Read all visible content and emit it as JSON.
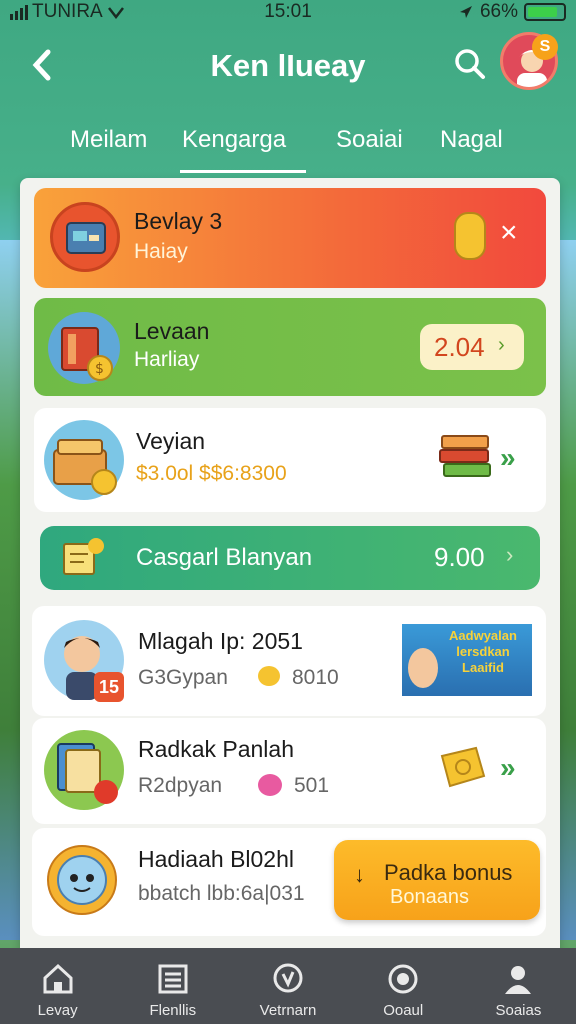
{
  "status": {
    "carrier": "TUNIRA",
    "time": "15:01",
    "battery": "66%"
  },
  "header": {
    "back_icon": "chevron-left-icon",
    "title": "Ken lIueay",
    "search_icon": "search-icon",
    "avatar_badge": "S"
  },
  "tabs": [
    {
      "label": "Meilam"
    },
    {
      "label": "Kengarga"
    },
    {
      "label": "Soaiai"
    },
    {
      "label": "Nagal"
    }
  ],
  "cards": {
    "c1": {
      "title": "Bevlay 3",
      "subtitle": "Haiay",
      "colors": [
        "#f9a23a",
        "#f2493d"
      ]
    },
    "c2": {
      "title": "Levaan",
      "subtitle": "Harliay",
      "value": "2.04"
    },
    "c3": {
      "title": "Veyian",
      "subtitle": "$3.0ol $$6:8300"
    },
    "c4": {
      "title": "Casgarl Blanyan",
      "value": "9.00"
    },
    "c5": {
      "title": "Mlagah Ip: 2051",
      "subtitle_a": "G3Gypan",
      "subtitle_b": "8010",
      "avatar_badge": "15",
      "banner_text": "Aadwyalan lersdkan Laaifid"
    },
    "c6": {
      "title": "Radkak Panlah",
      "subtitle_a": "R2dpyan",
      "subtitle_b": "501"
    },
    "c7": {
      "title": "Hadiaah Bl02hl",
      "subtitle": "bbatch lbb:6a|031",
      "bonus_title": "Padka bonus",
      "bonus_sub": "Bonaans"
    }
  },
  "nav": [
    {
      "label": "Levay",
      "icon": "home-icon"
    },
    {
      "label": "Flenllis",
      "icon": "list-icon"
    },
    {
      "label": "Vetrnarn",
      "icon": "badge-icon"
    },
    {
      "label": "Ooaul",
      "icon": "gear-icon"
    },
    {
      "label": "Soaias",
      "icon": "user-icon"
    }
  ]
}
